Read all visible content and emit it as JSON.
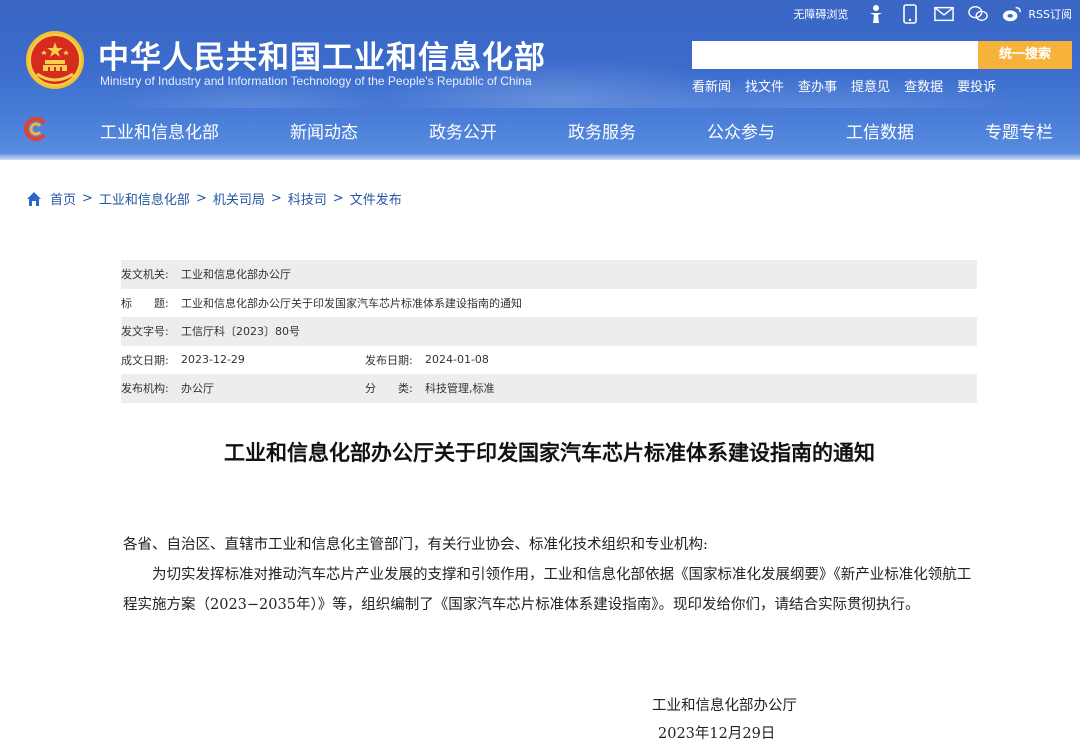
{
  "header": {
    "title_cn": "中华人民共和国工业和信息化部",
    "title_en": "Ministry of Industry and Information Technology of the People's Republic of China",
    "accessibility_label": "无障碍浏览",
    "rss_label": "RSS订阅",
    "icons": [
      "accessibility-icon",
      "mobile-icon",
      "mail-icon",
      "wechat-icon",
      "weibo-icon"
    ],
    "search_placeholder": "",
    "search_button": "统一搜索",
    "quicklinks": [
      "看新闻",
      "找文件",
      "查办事",
      "提意见",
      "查数据",
      "要投诉"
    ]
  },
  "nav": {
    "items": [
      "工业和信息化部",
      "新闻动态",
      "政务公开",
      "政务服务",
      "公众参与",
      "工信数据",
      "专题专栏"
    ]
  },
  "breadcrumb": {
    "items": [
      "首页",
      "工业和信息化部",
      "机关司局",
      "科技司",
      "文件发布"
    ],
    "separator": ">"
  },
  "meta": {
    "issuer_label": "发文机关:",
    "issuer": "工业和信息化部办公厅",
    "title_label_a": "标",
    "title_label_b": "题:",
    "title": "工业和信息化部办公厅关于印发国家汽车芯片标准体系建设指南的通知",
    "docno_label": "发文字号:",
    "docno": "工信厅科〔2023〕80号",
    "created_label": "成文日期:",
    "created": "2023-12-29",
    "published_label": "发布日期:",
    "published": "2024-01-08",
    "org_label": "发布机构:",
    "org": "办公厅",
    "category_label_a": "分",
    "category_label_b": "类:",
    "category": "科技管理,标准"
  },
  "document": {
    "title": "工业和信息化部办公厅关于印发国家汽车芯片标准体系建设指南的通知",
    "salutation": "各省、自治区、直辖市工业和信息化主管部门，有关行业协会、标准化技术组织和专业机构:",
    "paragraph1": "为切实发挥标准对推动汽车芯片产业发展的支撑和引领作用，工业和信息化部依据《国家标准化发展纲要》《新产业标准化领航工程实施方案（2023−2035年）》等，组织编制了《国家汽车芯片标准体系建设指南》。现印发给你们，请结合实际贯彻执行。",
    "signer": "工业和信息化部办公厅",
    "date": "2023年12月29日"
  },
  "colors": {
    "header_blue": "#3b6bcc",
    "search_button": "#f6b23a",
    "breadcrumb_link": "#2556a5",
    "meta_shade": "#ededed"
  }
}
